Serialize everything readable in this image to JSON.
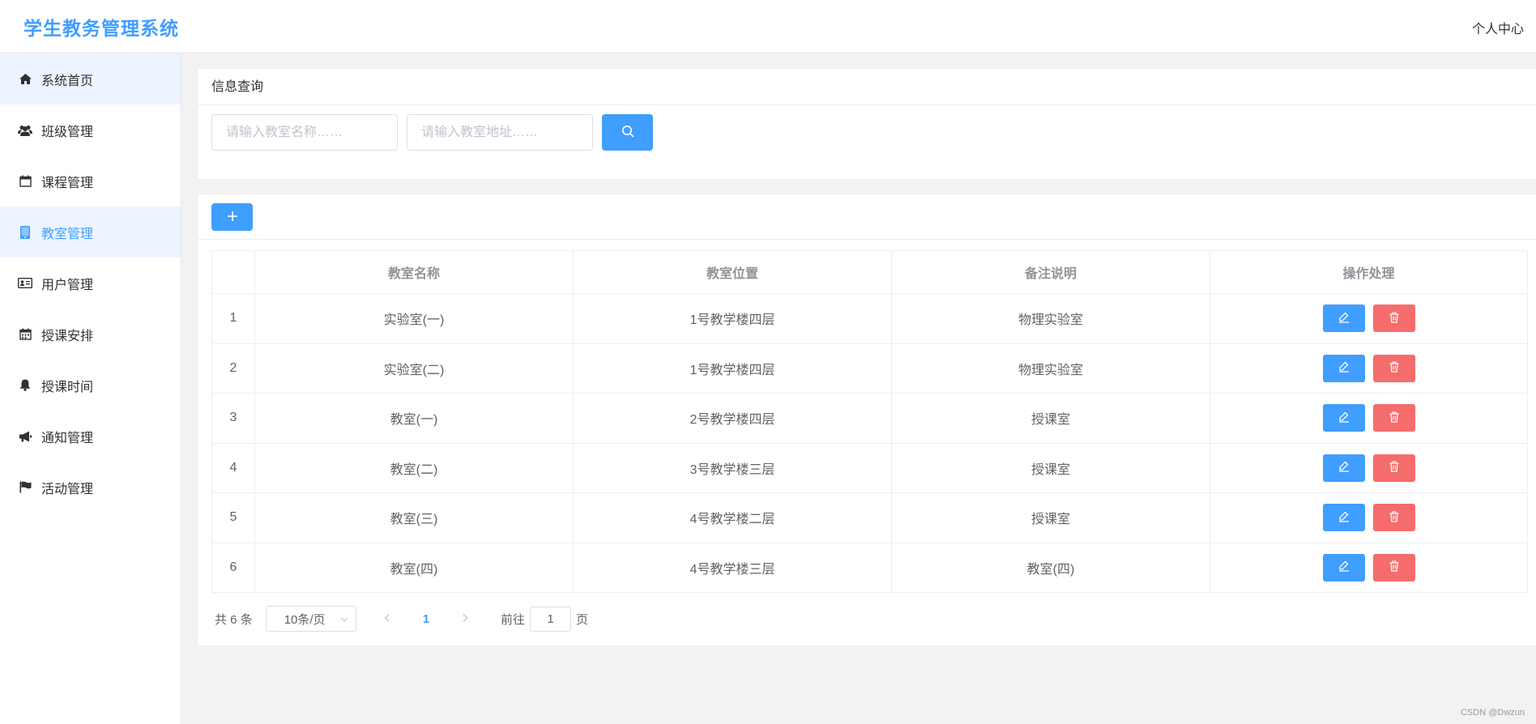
{
  "app": {
    "title": "学生教务管理系统",
    "user_center": "个人中心"
  },
  "sidebar": {
    "items": [
      {
        "label": "系统首页",
        "icon": "home-icon"
      },
      {
        "label": "班级管理",
        "icon": "users-icon"
      },
      {
        "label": "课程管理",
        "icon": "calendar-icon"
      },
      {
        "label": "教室管理",
        "icon": "tablet-icon"
      },
      {
        "label": "用户管理",
        "icon": "id-card-icon"
      },
      {
        "label": "授课安排",
        "icon": "calendar-grid-icon"
      },
      {
        "label": "授课时间",
        "icon": "bell-icon"
      },
      {
        "label": "通知管理",
        "icon": "bullhorn-icon"
      },
      {
        "label": "活动管理",
        "icon": "flag-icon"
      }
    ]
  },
  "search": {
    "title": "信息查询",
    "name_placeholder": "请输入教室名称……",
    "address_placeholder": "请输入教室地址……"
  },
  "table": {
    "headers": [
      "",
      "教室名称",
      "教室位置",
      "备注说明",
      "操作处理"
    ],
    "rows": [
      {
        "index": "1",
        "name": "实验室(一)",
        "location": "1号教学楼四层",
        "note": "物理实验室"
      },
      {
        "index": "2",
        "name": "实验室(二)",
        "location": "1号教学楼四层",
        "note": "物理实验室"
      },
      {
        "index": "3",
        "name": "教室(一)",
        "location": "2号教学楼四层",
        "note": "授课室"
      },
      {
        "index": "4",
        "name": "教室(二)",
        "location": "3号教学楼三层",
        "note": "授课室"
      },
      {
        "index": "5",
        "name": "教室(三)",
        "location": "4号教学楼二层",
        "note": "授课室"
      },
      {
        "index": "6",
        "name": "教室(四)",
        "location": "4号教学楼三层",
        "note": "教室(四)"
      }
    ]
  },
  "pagination": {
    "total": "共 6 条",
    "page_size": "10条/页",
    "current_page": "1",
    "goto_prefix": "前往",
    "goto_value": "1",
    "goto_suffix": "页"
  },
  "watermark": "CSDN @Dwzun",
  "colors": {
    "primary": "#409eff",
    "danger": "#f56c6c",
    "active_bg": "#ecf5ff"
  }
}
